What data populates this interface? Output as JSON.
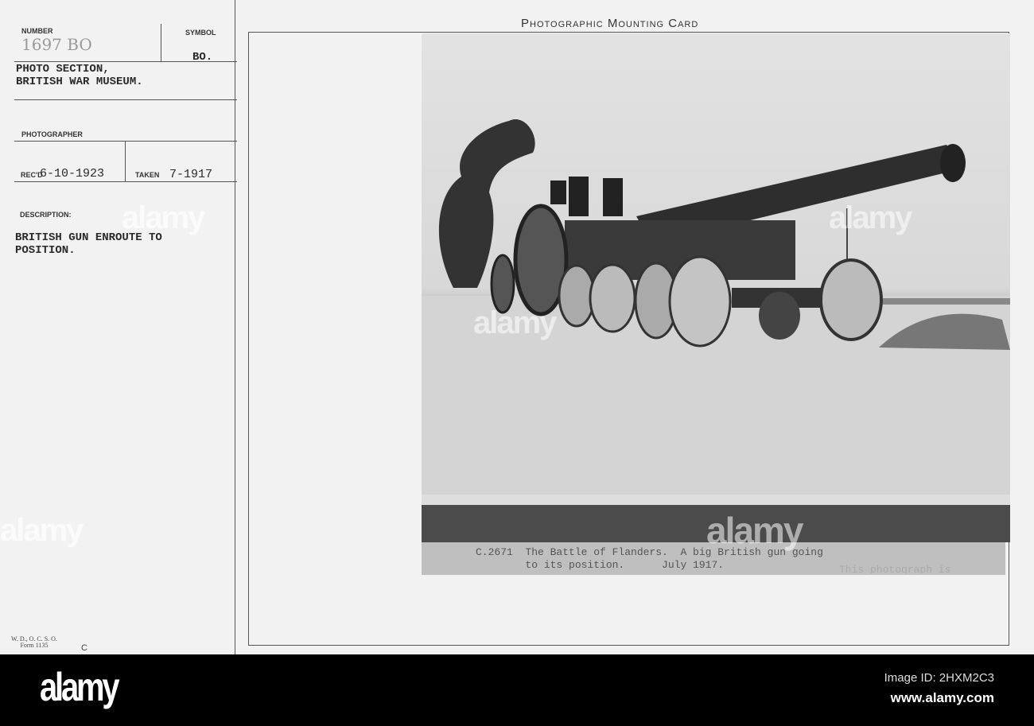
{
  "card_title": "Photographic Mounting Card",
  "left_panel": {
    "number_label": "NUMBER",
    "number_value": "1697 BO",
    "symbol_label": "SYMBOL",
    "symbol_value": "BO.",
    "section": "PHOTO SECTION,",
    "museum": "BRITISH WAR MUSEUM.",
    "photographer_label": "PHOTOGRAPHER",
    "recd_label": "REC'D",
    "recd_value": "6-10-1923",
    "taken_label": "TAKEN",
    "taken_value": "7-1917",
    "description_label": "DESCRIPTION:",
    "description_line1": "BRITISH GUN ENROUTE TO",
    "description_line2": "POSITION.",
    "form_line1": "W. D., O. C. S. O.",
    "form_line2": "Form 1135",
    "form_letter": "C"
  },
  "caption": {
    "line1": "C.2671  The Battle of Flanders.  A big British gun going",
    "line2": "        to its position.      July 1917.",
    "faded": "This photograph is"
  },
  "watermark": "alamy",
  "footer": {
    "logo": "alamy",
    "image_id": "Image ID: 2HXM2C3",
    "url": "www.alamy.com"
  }
}
